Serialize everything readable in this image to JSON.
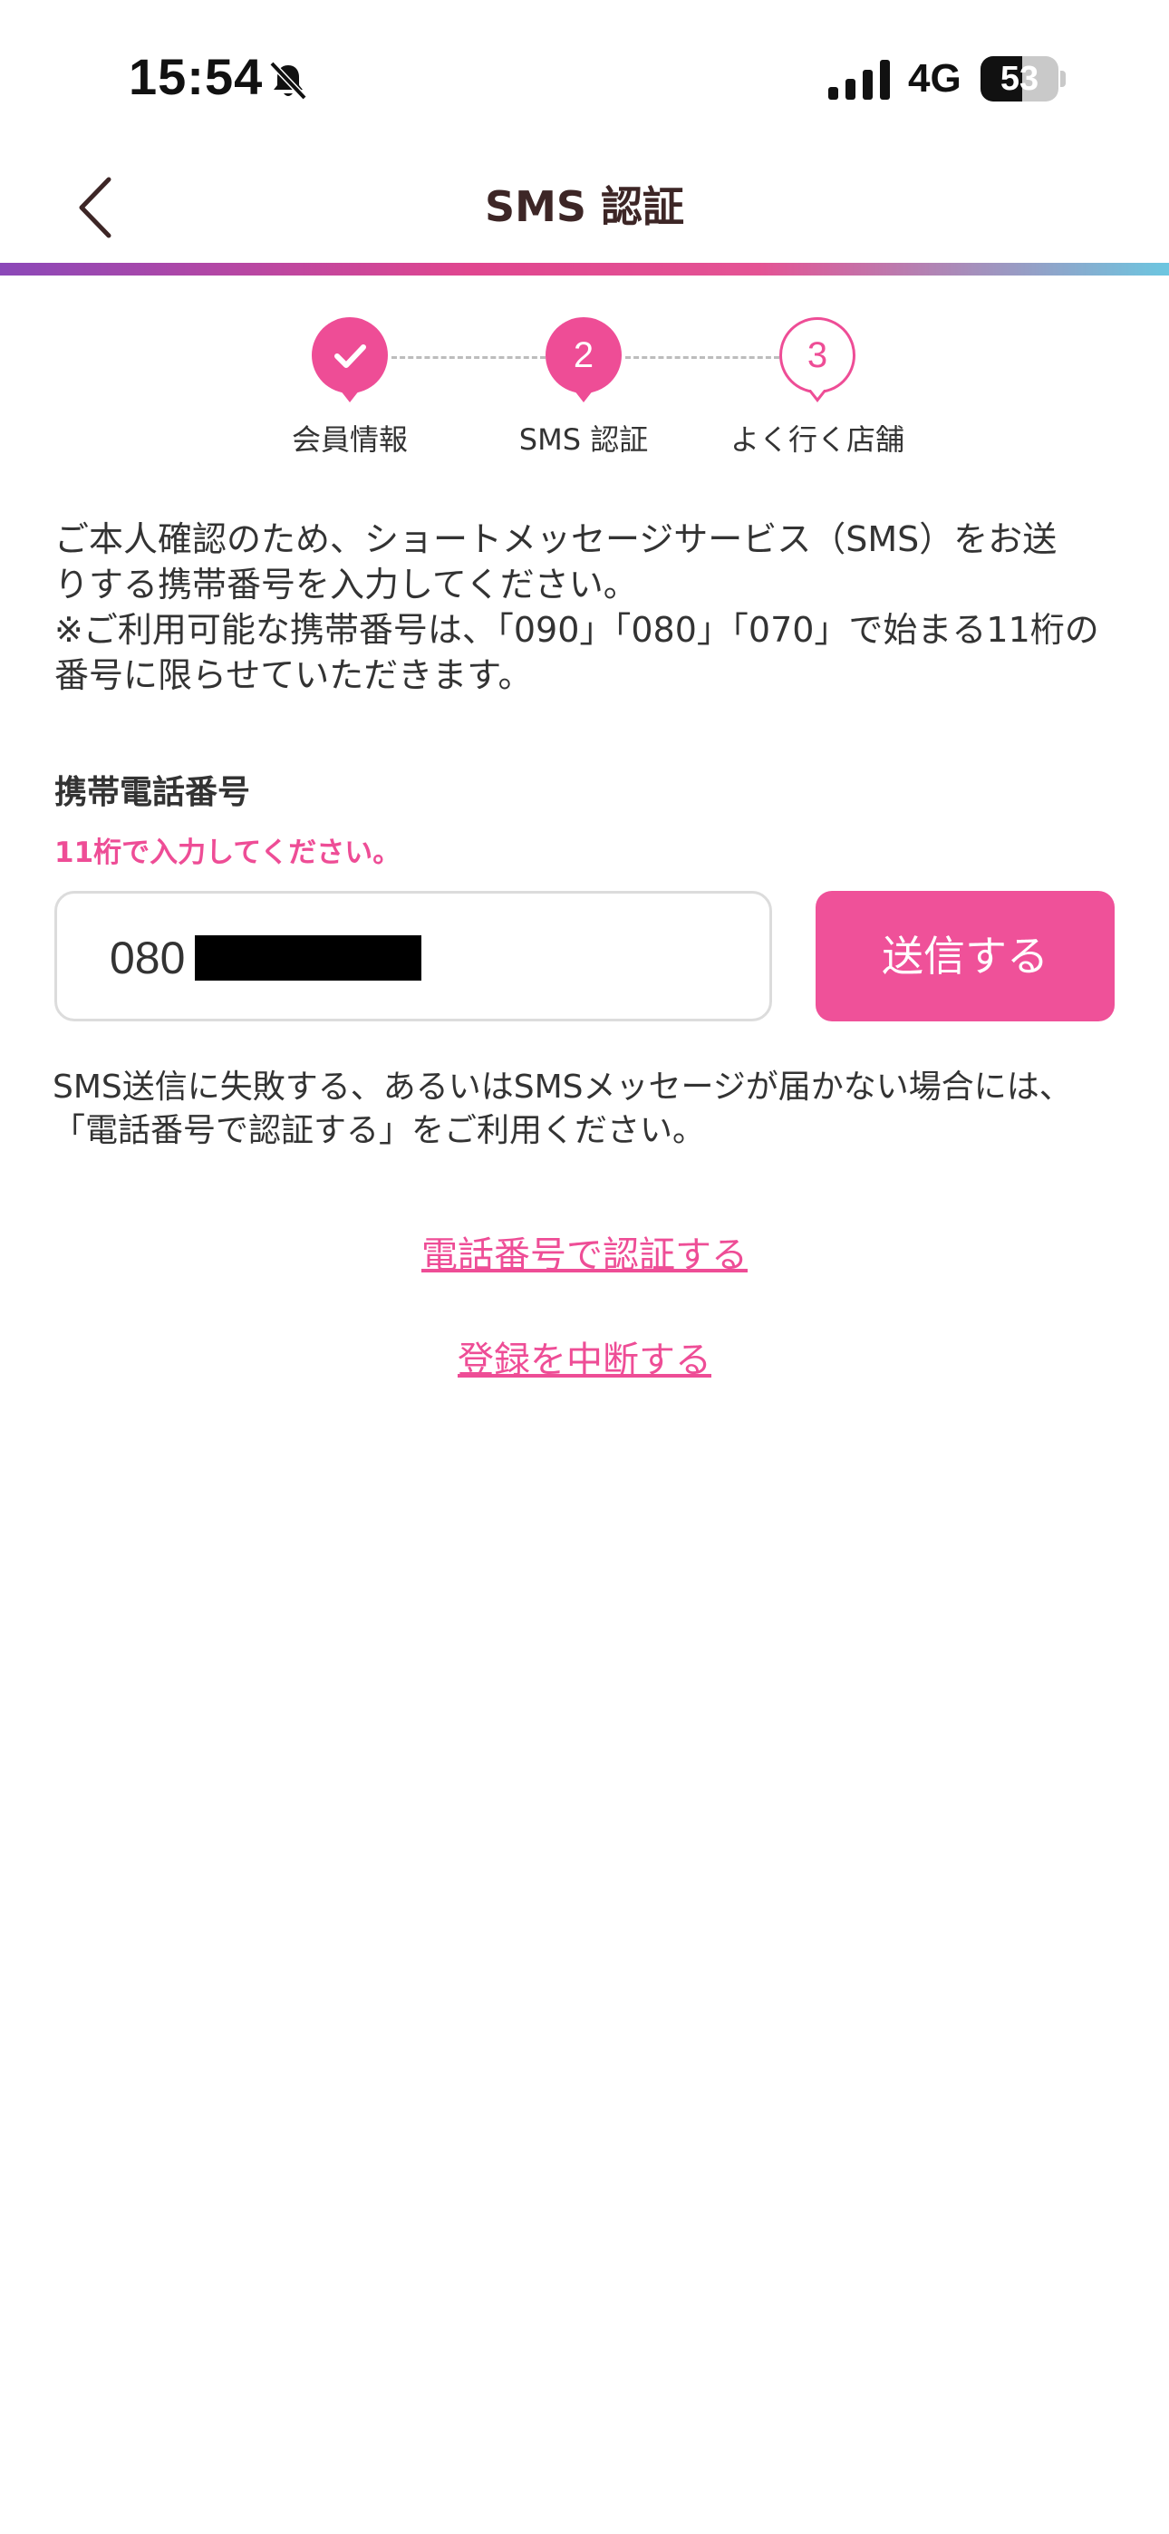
{
  "status_bar": {
    "time": "15:54",
    "network": "4G",
    "battery_level": "53",
    "battery_fraction": 0.53
  },
  "header": {
    "title": "SMS 認証"
  },
  "stepper": {
    "steps": [
      {
        "number": "",
        "label": "会員情報",
        "state": "completed"
      },
      {
        "number": "2",
        "label": "SMS 認証",
        "state": "current"
      },
      {
        "number": "3",
        "label": "よく行く店舗",
        "state": "upcoming"
      }
    ]
  },
  "description": {
    "line1": "ご本人確認のため、ショートメッセージサービス（SMS）をお送",
    "line2": "りする携帯番号を入力してください。",
    "line3": "※ご利用可能な携帯番号は、「090」「080」「070」で始まる11桁の",
    "line4": "番号に限らせていただきます。"
  },
  "phone_field": {
    "label": "携帯電話番号",
    "hint": "11桁で入力してください。",
    "value": "080"
  },
  "send_button": {
    "label": "送信する"
  },
  "fallback_note": {
    "line1": "SMS送信に失敗する、あるいはSMSメッセージが届かない場合には、",
    "line2": "「電話番号で認証する」をご利用ください。"
  },
  "links": {
    "phone_auth": "電話番号で認証する",
    "cancel_registration": "登録を中断する"
  },
  "colors": {
    "accent": "#ee4d96",
    "title": "#3d2626"
  }
}
